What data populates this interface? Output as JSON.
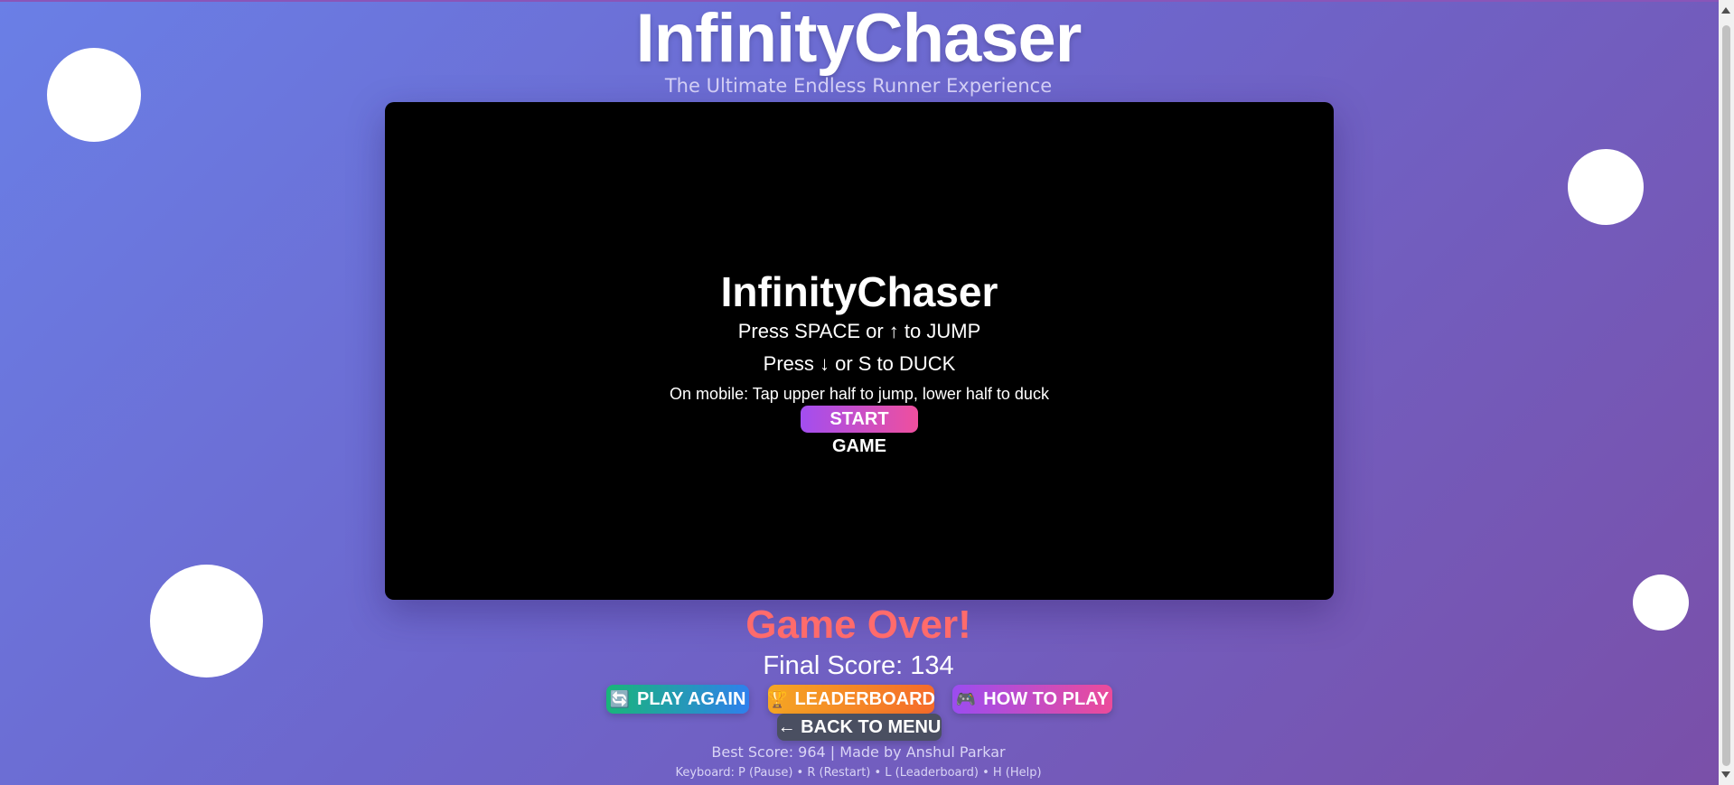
{
  "header": {
    "title": "InfinityChaser",
    "subtitle": "The Ultimate Endless Runner Experience"
  },
  "canvas": {
    "title": "InfinityChaser",
    "line_jump": "Press SPACE or ↑ to JUMP",
    "line_duck": "Press ↓ or S to DUCK",
    "line_mobile": "On mobile: Tap upper half to jump, lower half to duck",
    "start_label": "START GAME"
  },
  "game_over": {
    "heading": "Game Over!",
    "score_label": "Final Score: ",
    "score_value": "134"
  },
  "buttons": {
    "play_again": {
      "icon": "refresh-icon",
      "glyph": "🔄",
      "label": "PLAY AGAIN"
    },
    "leaderboard": {
      "icon": "trophy-icon",
      "glyph": "🏆",
      "label": "LEADERBOARD"
    },
    "how_to_play": {
      "icon": "gamepad-icon",
      "glyph": "🎮",
      "label": "HOW TO PLAY"
    },
    "back_to_menu": {
      "label": "← BACK TO MENU"
    }
  },
  "footer": {
    "best_line": "Best Score: 964 | Made by Anshul Parkar",
    "keys_line": "Keyboard: P (Pause) • R (Restart) • L (Leaderboard) • H (Help)"
  },
  "colors": {
    "game_over": "#ff6b6b",
    "canvas_bg": "#000000",
    "play_again_gradient": [
      "#19b57a",
      "#2f80ed"
    ],
    "leaderboard_gradient": [
      "#f5a623",
      "#f56b2a"
    ],
    "how_to_play_gradient": [
      "#9b4cf0",
      "#ec4b9a"
    ],
    "back_button": "#4a4f61"
  }
}
